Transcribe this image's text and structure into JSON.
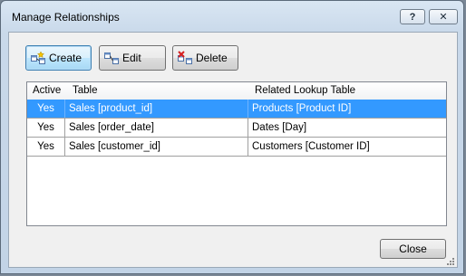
{
  "window": {
    "title": "Manage Relationships",
    "help_glyph": "?",
    "close_glyph": "✕"
  },
  "toolbar": {
    "create_label": "Create",
    "edit_label": "Edit",
    "delete_label": "Delete"
  },
  "grid": {
    "columns": [
      "Active",
      "Table",
      "Related Lookup Table"
    ],
    "rows": [
      {
        "active": "Yes",
        "table": "Sales [product_id]",
        "related": "Products [Product ID]",
        "selected": true
      },
      {
        "active": "Yes",
        "table": "Sales [order_date]",
        "related": "Dates [Day]",
        "selected": false
      },
      {
        "active": "Yes",
        "table": "Sales [customer_id]",
        "related": "Customers [Customer ID]",
        "selected": false
      }
    ]
  },
  "footer": {
    "close_label": "Close"
  },
  "colors": {
    "selection": "#3399ff",
    "title_bar": "#c9d9ea"
  }
}
